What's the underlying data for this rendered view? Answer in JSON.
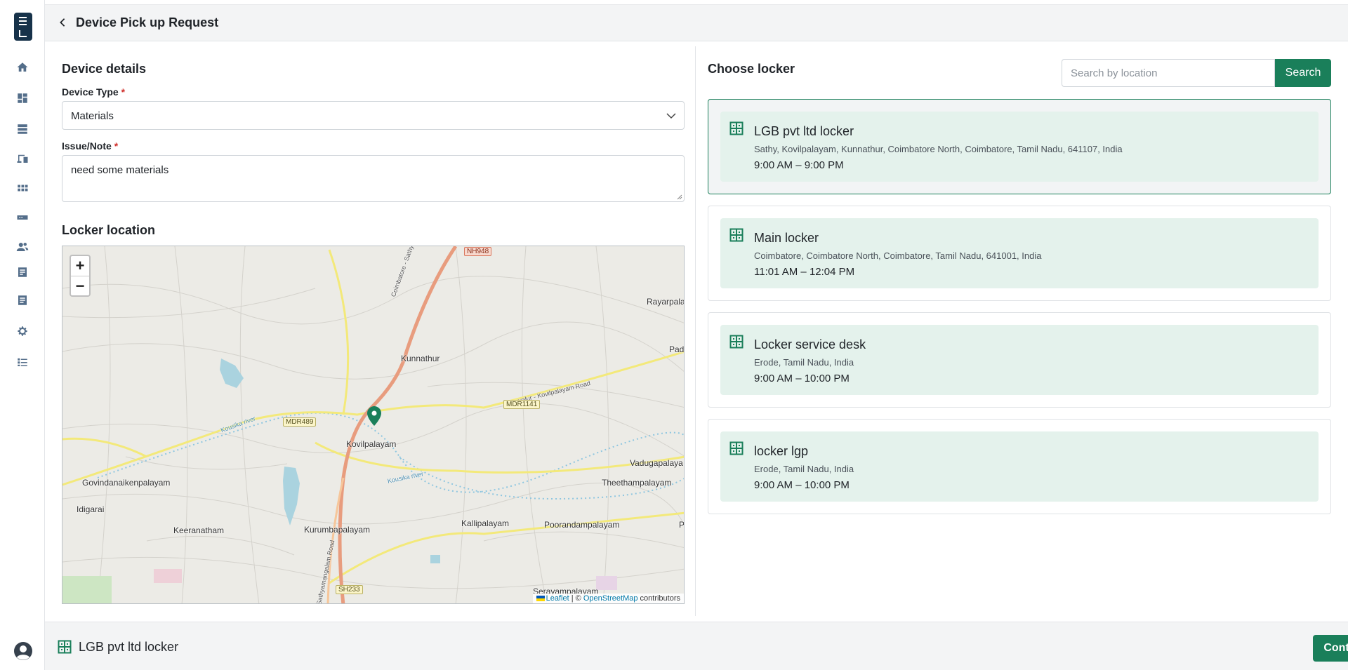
{
  "header": {
    "title": "Device Pick up Request"
  },
  "sidebar": {
    "items": [
      {
        "icon": "home-icon"
      },
      {
        "icon": "dashboard-icon"
      },
      {
        "icon": "storage-icon"
      },
      {
        "icon": "devices-icon"
      },
      {
        "icon": "apps-grid-icon"
      },
      {
        "icon": "hardware-icon"
      },
      {
        "icon": "users-icon"
      },
      {
        "icon": "list-icon"
      },
      {
        "icon": "document-icon"
      },
      {
        "icon": "settings-icon"
      },
      {
        "icon": "checklist-icon"
      }
    ]
  },
  "device_details": {
    "title": "Device details",
    "device_type_label": "Device Type",
    "device_type_value": "Materials",
    "issue_label": "Issue/Note",
    "issue_value": "need some materials",
    "required_mark": "*"
  },
  "locker_location": {
    "title": "Locker location",
    "zoom_in": "+",
    "zoom_out": "−",
    "places": [
      "Kunnathur",
      "Kovilpalayam",
      "Govindanaikenpalayam",
      "Idigarai",
      "Keeranatham",
      "Kurumbapalayam",
      "Kallipalayam",
      "Poorandampalayam",
      "Theethampalayam",
      "Vadugapalaya",
      "Rayarpala",
      "Padu",
      "Serayampalayam",
      "P"
    ],
    "road_tags": [
      "NH948",
      "MDR489",
      "MDR1141",
      "SH233"
    ],
    "road_names": [
      "Coimbatore - Sathyamangalam Road",
      "Karuvalur - Kovilpalayam Road",
      "Kousika river",
      "Kousika river",
      "Sathyamangalam Road"
    ],
    "attribution": {
      "leaflet": "Leaflet",
      "sep": " | © ",
      "osm": "OpenStreetMap",
      "rest": " contributors"
    }
  },
  "choose_locker": {
    "title": "Choose locker",
    "search_placeholder": "Search by location",
    "search_button": "Search",
    "lockers": [
      {
        "name": "LGB pvt ltd locker",
        "address": "Sathy, Kovilpalayam, Kunnathur, Coimbatore North, Coimbatore, Tamil Nadu, 641107, India",
        "hours": "9:00 AM – 9:00 PM",
        "selected": true
      },
      {
        "name": "Main locker",
        "address": "Coimbatore, Coimbatore North, Coimbatore, Tamil Nadu, 641001, India",
        "hours": "11:01 AM – 12:04 PM",
        "selected": false
      },
      {
        "name": "Locker service desk",
        "address": "Erode, Tamil Nadu, India",
        "hours": "9:00 AM – 10:00 PM",
        "selected": false
      },
      {
        "name": "locker lgp",
        "address": "Erode, Tamil Nadu, India",
        "hours": "9:00 AM – 10:00 PM",
        "selected": false
      }
    ]
  },
  "footer": {
    "selected_locker": "LGB pvt ltd locker",
    "continue_button": "Continue"
  },
  "colors": {
    "accent": "#1a7f5a",
    "card_bg": "#e4f2ec",
    "required": "#d0312d",
    "brand": "#17324a"
  }
}
